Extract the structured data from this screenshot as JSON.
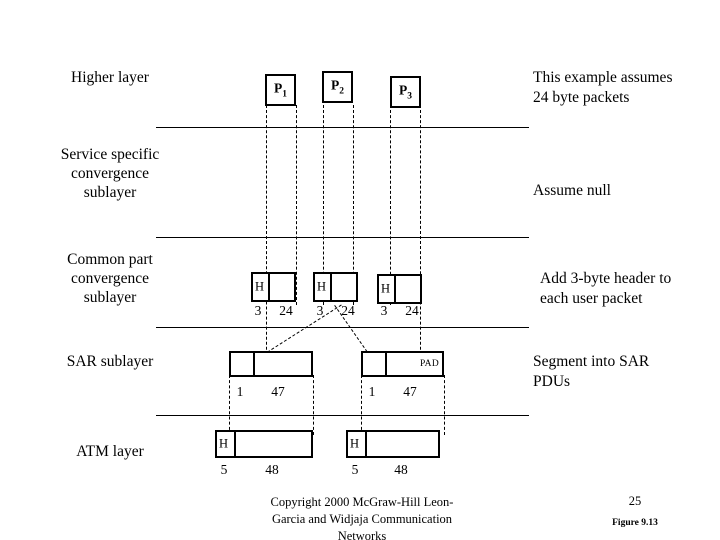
{
  "slide": {
    "page_number": "25",
    "figure_number": "Figure 9.13",
    "copyright": "Copyright 2000 McGraw-Hill Leon-\nGarcia and Widjaja  Communication\nNetworks"
  },
  "layers": [
    {
      "id": "higher-layer",
      "label": "Higher layer"
    },
    {
      "id": "service-specific-convergence-sublayer",
      "label": "Service specific\nconvergence\nsublayer"
    },
    {
      "id": "common-part-convergence-sublayer",
      "label": "Common part\nconvergence\nsublayer"
    },
    {
      "id": "sar-sublayer",
      "label": "SAR sublayer"
    },
    {
      "id": "atm-layer",
      "label": "ATM layer"
    }
  ],
  "notes": [
    {
      "id": "note-packet-size",
      "text": "This example assumes\n24 byte packets"
    },
    {
      "id": "note-assume-null",
      "text": "Assume null"
    },
    {
      "id": "note-add-header",
      "text": "Add 3-byte header to\neach user packet"
    },
    {
      "id": "note-segment",
      "text": "Segment into SAR\nPDUs"
    }
  ],
  "higher_layer_packets": [
    {
      "name": "P",
      "sub": "1"
    },
    {
      "name": "P",
      "sub": "2"
    },
    {
      "name": "P",
      "sub": "3"
    }
  ],
  "cpcs_pdus": [
    {
      "header_label": "H",
      "header_size": "3",
      "payload_size": "24"
    },
    {
      "header_label": "H",
      "header_size": "3",
      "payload_size": "24"
    },
    {
      "header_label": "H",
      "header_size": "3",
      "payload_size": "24"
    }
  ],
  "sar_pdus": [
    {
      "header_size": "1",
      "payload_size": "47",
      "pad": ""
    },
    {
      "header_size": "1",
      "payload_size": "47",
      "pad": "PAD"
    }
  ],
  "atm_cells": [
    {
      "header_label": "H",
      "header_size": "5",
      "payload_size": "48"
    },
    {
      "header_label": "H",
      "header_size": "5",
      "payload_size": "48"
    }
  ],
  "colors": {
    "ink": "#000000",
    "background": "#ffffff"
  }
}
